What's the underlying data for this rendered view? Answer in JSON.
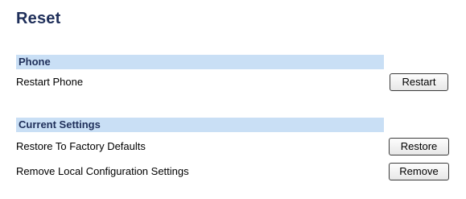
{
  "page": {
    "title": "Reset"
  },
  "sections": [
    {
      "header": "Phone",
      "rows": [
        {
          "label": "Restart Phone",
          "button": "Restart"
        }
      ]
    },
    {
      "header": "Current Settings",
      "rows": [
        {
          "label": "Restore To Factory Defaults",
          "button": "Restore"
        },
        {
          "label": "Remove Local Configuration Settings",
          "button": "Remove"
        }
      ]
    }
  ],
  "colors": {
    "title": "#1f2f5a",
    "section_header_bg": "#c9dff5",
    "section_header_text": "#1f2f5a"
  }
}
